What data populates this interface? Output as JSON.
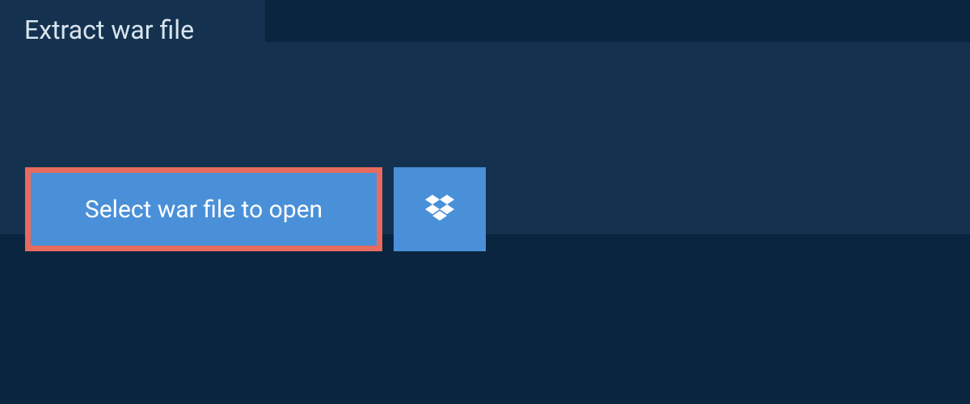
{
  "tab": {
    "label": "Extract war file"
  },
  "buttons": {
    "select_file_label": "Select war file to open"
  }
}
